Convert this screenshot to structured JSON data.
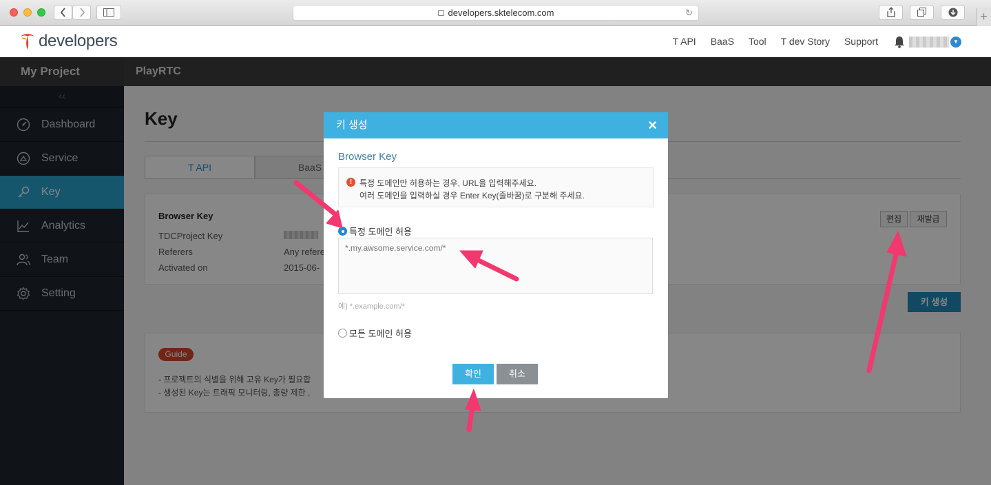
{
  "browser": {
    "url": "developers.sktelecom.com",
    "plus": "+"
  },
  "header": {
    "logo_text": "developers",
    "nav": [
      "T API",
      "BaaS",
      "Tool",
      "T dev Story",
      "Support"
    ]
  },
  "sidebar": {
    "title": "My Project",
    "collapse": "‹‹",
    "items": [
      {
        "label": "Dashboard",
        "icon": "gauge-icon"
      },
      {
        "label": "Service",
        "icon": "service-icon"
      },
      {
        "label": "Key",
        "icon": "key-icon",
        "active": true
      },
      {
        "label": "Analytics",
        "icon": "chart-icon"
      },
      {
        "label": "Team",
        "icon": "team-icon"
      },
      {
        "label": "Setting",
        "icon": "gear-icon"
      }
    ]
  },
  "project": {
    "name": "PlayRTC"
  },
  "page": {
    "title": "Key",
    "tabs": [
      "T API",
      "BaaS"
    ],
    "card": {
      "title": "Browser Key",
      "labels": [
        "TDCProject Key",
        "Referers",
        "Activated on"
      ],
      "referers_value": "Any refere",
      "activated_value": "2015-06-"
    },
    "edit_button": "편집",
    "reissue_button": "재발급",
    "create_button": "키 생성",
    "guide": {
      "badge": "Guide",
      "lines": [
        "- 프로젝트의 식별을 위해 고유 Key가 필요합",
        "- 생성된 Key는 트래픽 모니터링, 총량 제한 ,"
      ]
    }
  },
  "modal": {
    "title": "키 생성",
    "close": "×",
    "section_title": "Browser Key",
    "notice_lines": [
      "특정 도메인만 허용하는 경우, URL을 입력해주세요.",
      "여러 도메인을 입력하실 경우 Enter Key(줄바꿈)로 구분해 주세요."
    ],
    "warn_glyph": "!",
    "option_specific": "특정 도메인 허용",
    "textarea_placeholder": "*.my.awsome.service.com/*",
    "example": "예) *.example.com/*",
    "option_all": "모든 도메인 허용",
    "ok": "확인",
    "cancel": "취소"
  },
  "colors": {
    "accent": "#3fb1e0",
    "sidebar_active": "#2aa3cf",
    "guide_badge": "#d9452f",
    "annotation_arrow": "#f2386e"
  }
}
